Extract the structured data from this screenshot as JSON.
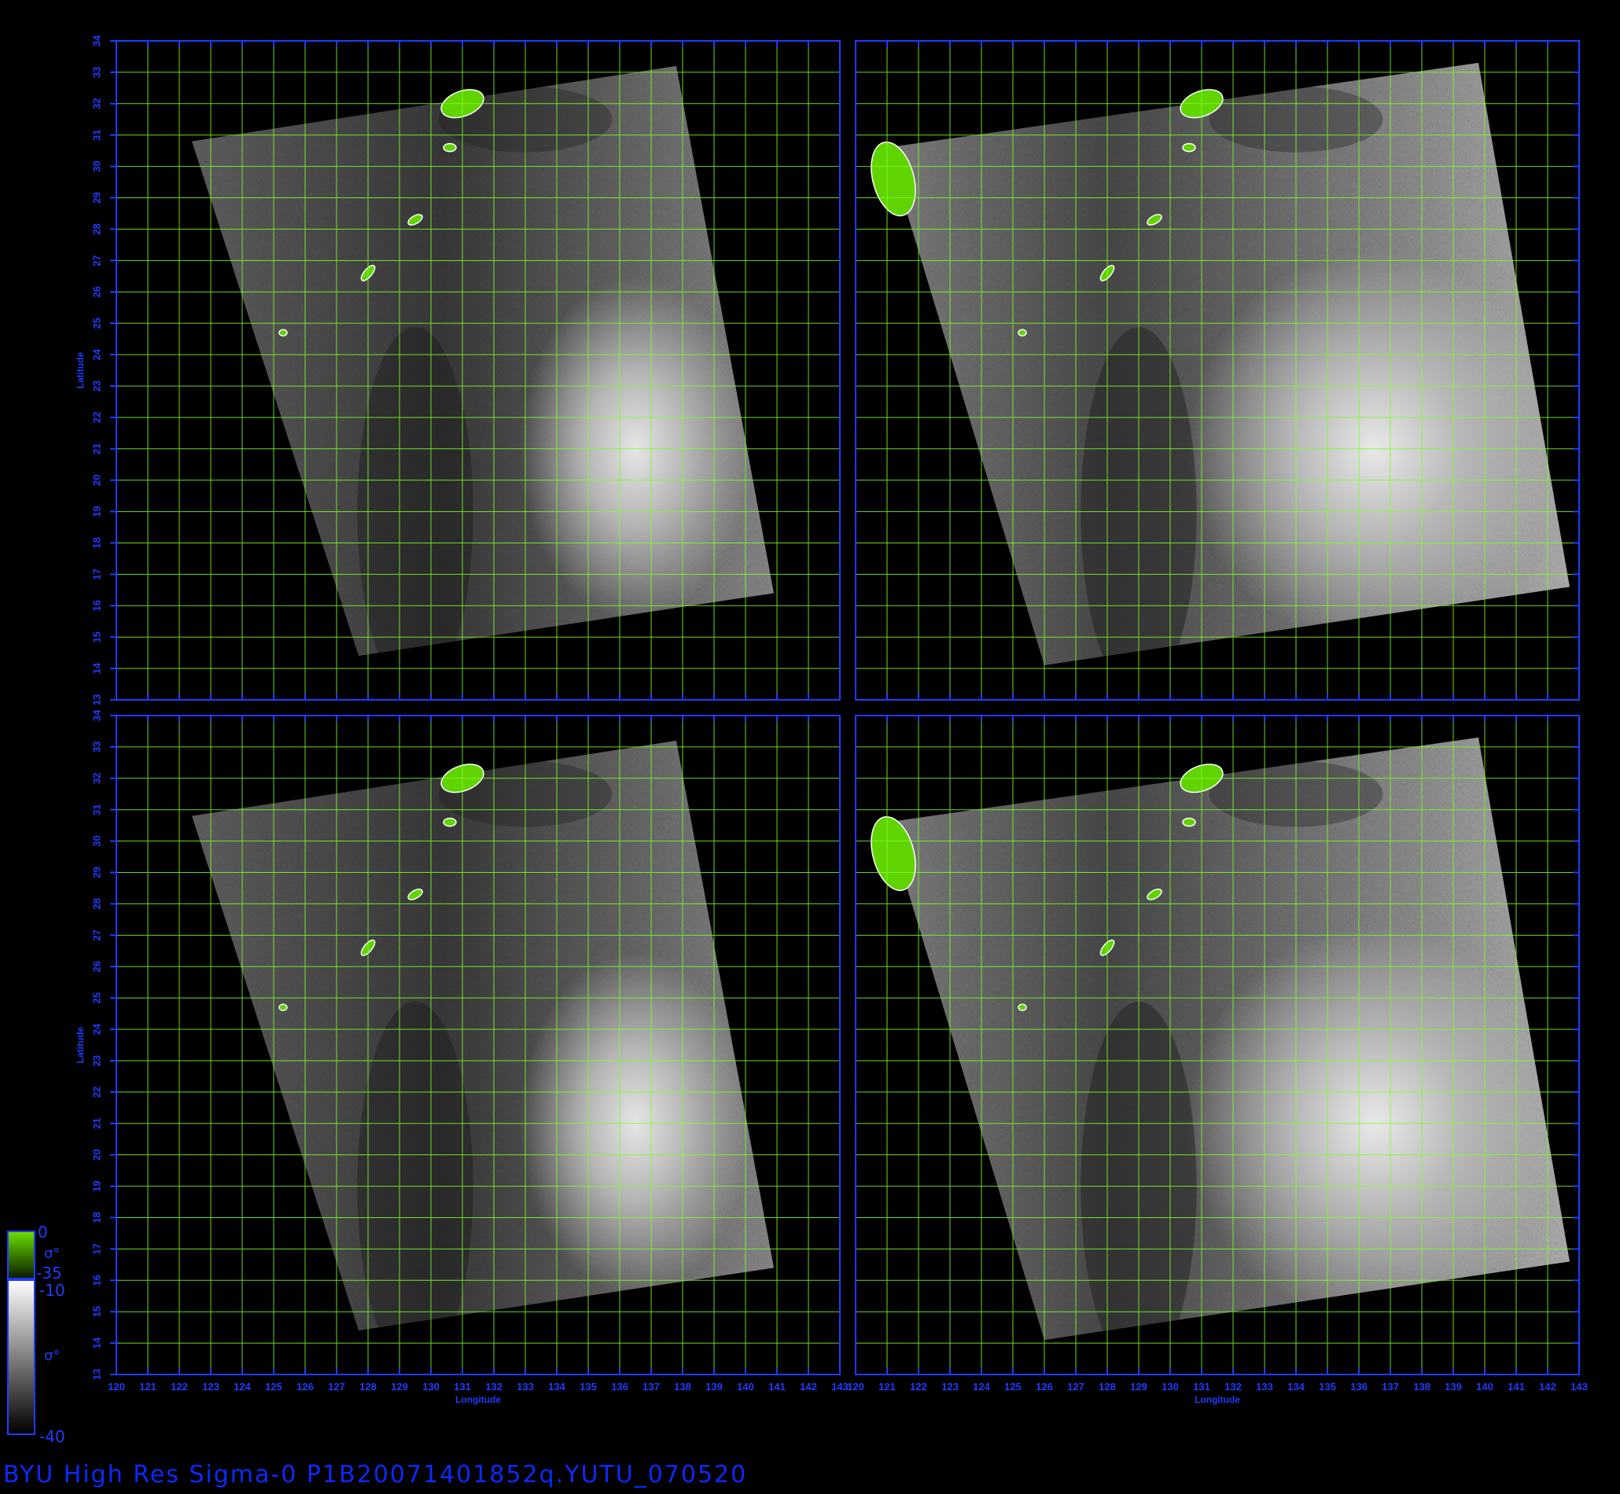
{
  "caption": "BYU  High  Res  Sigma-0  P1B20071401852q.YUTU_070520",
  "axes": {
    "x_label": "Longitude",
    "y_label": "Latitude",
    "lon_range": [
      120,
      143
    ],
    "lat_range": [
      13,
      34
    ],
    "lon_ticks": [
      "120",
      "121",
      "122",
      "123",
      "124",
      "125",
      "126",
      "127",
      "128",
      "129",
      "130",
      "131",
      "132",
      "133",
      "134",
      "135",
      "136",
      "137",
      "138",
      "139",
      "140",
      "141",
      "142",
      "143"
    ],
    "lat_ticks": [
      "13",
      "14",
      "15",
      "16",
      "17",
      "18",
      "19",
      "20",
      "21",
      "22",
      "23",
      "24",
      "25",
      "26",
      "27",
      "28",
      "29",
      "30",
      "31",
      "32",
      "33",
      "34"
    ]
  },
  "colorbar": {
    "land_top": "0",
    "land_symbol": "σ°",
    "land_bottom": "-35",
    "ocean_top": "-10",
    "ocean_symbol": "σ°",
    "ocean_bottom": "-40"
  },
  "colors": {
    "frame": "#1f3cff",
    "grid": "#7cff2a",
    "land": "#5fd400",
    "tick_text": "#1f3cff",
    "background": "#000000"
  },
  "panels": [
    {
      "name": "top-left"
    },
    {
      "name": "top-right"
    },
    {
      "name": "bottom-left"
    },
    {
      "name": "bottom-right"
    }
  ]
}
